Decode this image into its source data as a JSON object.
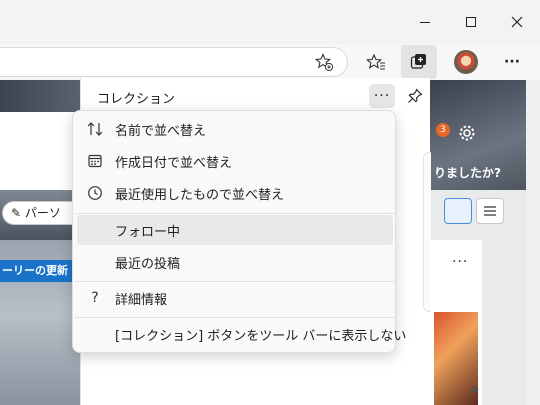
{
  "window_controls": {
    "minimize": "—",
    "maximize": "☐",
    "close": "✕"
  },
  "toolbar": {
    "icons": [
      "add-favorite-icon",
      "favorites-icon",
      "collections-icon",
      "profile-avatar",
      "more-icon"
    ],
    "more_label": "···"
  },
  "web_page": {
    "pill_label": "パーソ",
    "ribbon_text": "ーリーの更新",
    "banner_text": "りましたか?",
    "badge_count": "3"
  },
  "collections_pane": {
    "title": "コレクション",
    "more_label": "···"
  },
  "context_menu": {
    "sort_items": [
      {
        "icon": "sort-arrows-icon",
        "label": "名前で並べ替え"
      },
      {
        "icon": "calendar-icon",
        "label": "作成日付で並べ替え"
      },
      {
        "icon": "clock-icon",
        "label": "最近使用したもので並べ替え"
      }
    ],
    "feed_items": [
      {
        "label": "フォロー中"
      },
      {
        "label": "最近の投稿"
      }
    ],
    "info_item": {
      "icon": "question-icon",
      "glyph": "?",
      "label": "詳細情報"
    },
    "hide_item": {
      "label": "[コレクション] ボタンをツール バーに表示しない"
    }
  },
  "card": {
    "more_label": "···"
  },
  "colors": {
    "accent_blue": "#1a73c9",
    "menu_bg": "#f9f9f9",
    "badge": "#e8662a"
  }
}
